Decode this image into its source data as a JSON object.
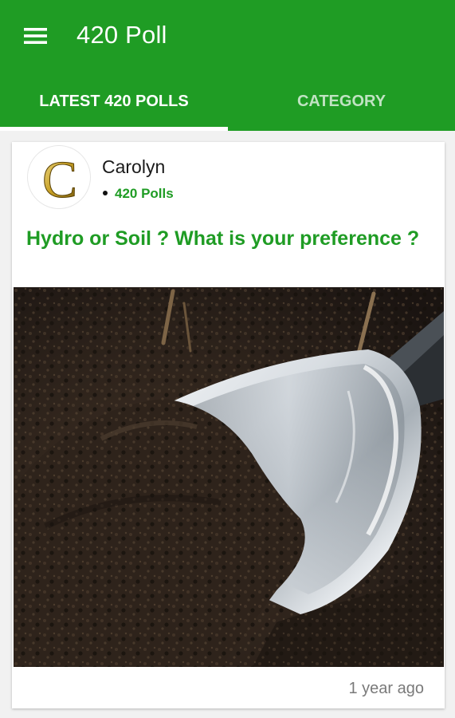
{
  "app": {
    "title": "420 Poll",
    "accent_color": "#1f9c24",
    "menu_icon": "hamburger-menu-icon"
  },
  "tabs": [
    {
      "label": "LATEST 420 POLLS",
      "selected": true
    },
    {
      "label": "CATEGORY",
      "selected": false
    }
  ],
  "post": {
    "author": {
      "name": "Carolyn",
      "avatar_letter": "C",
      "avatar_icon": "gold-letter-avatar"
    },
    "category": "420 Polls",
    "title": "Hydro or Soil ? What is your preference ?",
    "image": "soil-with-metal-trowel-photo",
    "timestamp": "1 year ago"
  }
}
